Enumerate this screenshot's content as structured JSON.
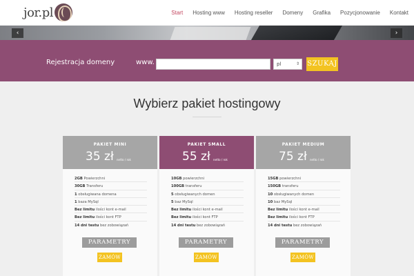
{
  "header": {
    "logo_text": "jor.pl",
    "nav": [
      "Start",
      "Hosting www",
      "Hosting reseller",
      "Domeny",
      "Grafika",
      "Pozycjonowanie",
      "Kontakt"
    ]
  },
  "slider": {
    "prev": "‹",
    "next": "›"
  },
  "domain_search": {
    "title": "Rejestracja domeny",
    "www_label": "www.",
    "input_value": "",
    "tld_selected": "pl",
    "search_button": "SZUKAJ"
  },
  "section": {
    "title": "Wybierz pakiet hostingowy"
  },
  "plans": [
    {
      "name": "PAKIET MINI",
      "price": "35 zł",
      "price_unit": "netto / rok",
      "features": [
        [
          "2GB",
          "Powierzchni"
        ],
        [
          "30GB",
          "Transferu"
        ],
        [
          "1",
          "obsługiwana domena"
        ],
        [
          "1",
          "baza MySql"
        ],
        [
          "Bez limitu",
          "ilości kont e-mail"
        ],
        [
          "Bez limitu",
          "ilości kont FTP"
        ],
        [
          "14 dni testu",
          "bez zobowiązań"
        ]
      ],
      "params_button": "PARAMETRY",
      "order_button": "ZAMÓW"
    },
    {
      "name": "PAKIET SMALL",
      "price": "55 zł",
      "price_unit": "netto / rok",
      "features": [
        [
          "10GB",
          "powierzchni"
        ],
        [
          "100GB",
          "transferu"
        ],
        [
          "5",
          "obsługiwanych domen"
        ],
        [
          "5",
          "baz MySql"
        ],
        [
          "Bez limitu",
          "ilości kont e-mail"
        ],
        [
          "Bez limitu",
          "ilości kont FTP"
        ],
        [
          "14 dni testu",
          "bez zobowiązań"
        ]
      ],
      "params_button": "PARAMETRY",
      "order_button": "ZAMÓW"
    },
    {
      "name": "PAKIET MEDIUM",
      "price": "75 zł",
      "price_unit": "netto / rok",
      "features": [
        [
          "15GB",
          "powierzchni"
        ],
        [
          "150GB",
          "transferu"
        ],
        [
          "10",
          "obsługiwanych domen"
        ],
        [
          "10",
          "baz MySql"
        ],
        [
          "Bez limitu",
          "ilości kont e-mail"
        ],
        [
          "Bez limitu",
          "ilości kont FTP"
        ],
        [
          "14 dni testu",
          "bez zobowiązań"
        ]
      ],
      "params_button": "PARAMETRY",
      "order_button": "ZAMÓW"
    }
  ],
  "colors": {
    "accent": "#8e4d73",
    "button_yellow": "#f3c321",
    "nav_active": "#c3465f",
    "card_grey": "#a6a6a6"
  }
}
